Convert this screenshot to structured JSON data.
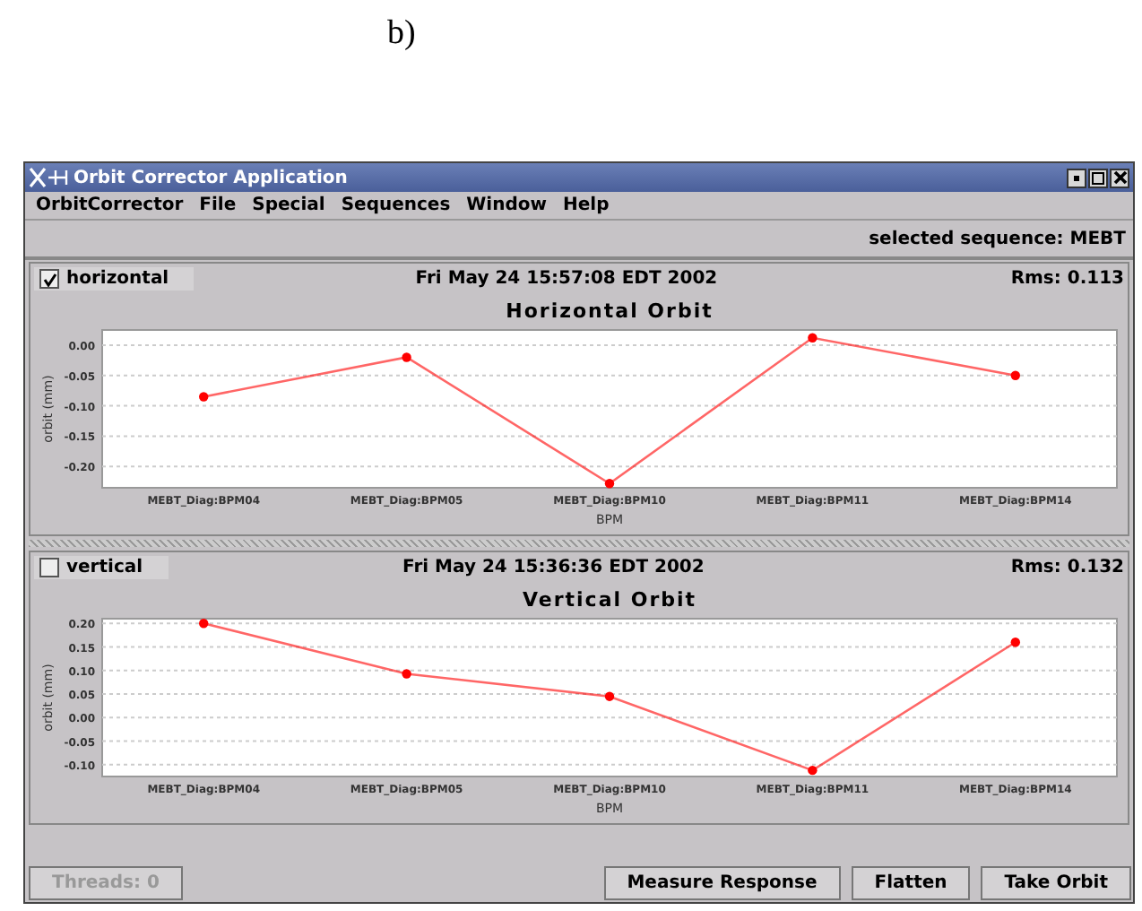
{
  "figure_label": "b)",
  "window": {
    "title": "Orbit Corrector Application"
  },
  "menu": [
    "OrbitCorrector",
    "File",
    "Special",
    "Sequences",
    "Window",
    "Help"
  ],
  "sequence_status": "selected sequence: MEBT",
  "panels": [
    {
      "label": "horizontal",
      "checked": true,
      "timestamp": "Fri May 24 15:57:08 EDT 2002",
      "rms": "Rms: 0.113",
      "chart_data": {
        "type": "line",
        "title": "Horizontal Orbit",
        "xlabel": "BPM",
        "ylabel": "orbit (mm)",
        "categories": [
          "MEBT_Diag:BPM04",
          "MEBT_Diag:BPM05",
          "MEBT_Diag:BPM10",
          "MEBT_Diag:BPM11",
          "MEBT_Diag:BPM14"
        ],
        "grid": true,
        "series": [
          {
            "color": "#ff0000",
            "marker": "circle",
            "values": [
              -0.085,
              -0.02,
              -0.228,
              0.012,
              -0.05
            ]
          }
        ],
        "ylim": [
          -0.235,
          0.025
        ],
        "yticks": [
          {
            "value": 0,
            "label": "0.00"
          },
          {
            "value": -0.05,
            "label": "-0.05"
          },
          {
            "value": -0.1,
            "label": "-0.10"
          },
          {
            "value": -0.15,
            "label": "-0.15"
          },
          {
            "value": -0.2,
            "label": "-0.20"
          }
        ]
      }
    },
    {
      "label": "vertical",
      "checked": false,
      "timestamp": "Fri May 24 15:36:36 EDT 2002",
      "rms": "Rms: 0.132",
      "chart_data": {
        "type": "line",
        "title": "Vertical Orbit",
        "xlabel": "BPM",
        "ylabel": "orbit (mm)",
        "categories": [
          "MEBT_Diag:BPM04",
          "MEBT_Diag:BPM05",
          "MEBT_Diag:BPM10",
          "MEBT_Diag:BPM11",
          "MEBT_Diag:BPM14"
        ],
        "grid": true,
        "series": [
          {
            "color": "#ff0000",
            "marker": "circle",
            "values": [
              0.2,
              0.093,
              0.045,
              -0.112,
              0.16
            ]
          }
        ],
        "ylim": [
          -0.125,
          0.21
        ],
        "yticks": [
          {
            "value": 0.2,
            "label": "0.20"
          },
          {
            "value": 0.15,
            "label": "0.15"
          },
          {
            "value": 0.1,
            "label": "0.10"
          },
          {
            "value": 0.05,
            "label": "0.05"
          },
          {
            "value": 0,
            "label": "0.00"
          },
          {
            "value": -0.05,
            "label": "-0.05"
          },
          {
            "value": -0.1,
            "label": "-0.10"
          }
        ]
      }
    }
  ],
  "buttons": [
    {
      "label": "Threads: 0",
      "disabled": true
    },
    {
      "label": "Measure Response",
      "disabled": false
    },
    {
      "label": "Flatten",
      "disabled": false
    },
    {
      "label": "Take Orbit",
      "disabled": false
    }
  ]
}
